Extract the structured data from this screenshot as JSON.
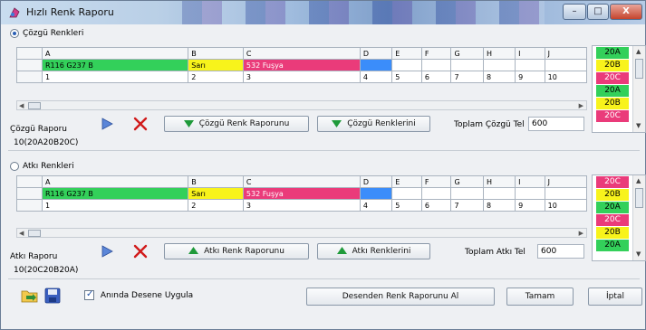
{
  "window": {
    "title": "Hızlı Renk Raporu",
    "minimize": "–",
    "maximize": "□",
    "close": "X"
  },
  "columns": [
    "A",
    "B",
    "C",
    "D",
    "E",
    "F",
    "G",
    "H",
    "I",
    "J"
  ],
  "colors": {
    "green": "#33d05a",
    "yellow": "#f8f31b",
    "pink": "#ea3b7a",
    "blue": "#3b8dfa"
  },
  "warp": {
    "section_label": "Çözgü Renkleri",
    "selected": true,
    "color_row": [
      "R116 G237 B",
      "Sarı",
      "532 Fuşya",
      "",
      "",
      "",
      "",
      "",
      "",
      ""
    ],
    "index_row": [
      "1",
      "2",
      "3",
      "4",
      "5",
      "6",
      "7",
      "8",
      "9",
      "10"
    ],
    "swatches": [
      {
        "label": "20A",
        "color": "#33d05a"
      },
      {
        "label": "20B",
        "color": "#f8f31b"
      },
      {
        "label": "20C",
        "color": "#ea3b7a"
      },
      {
        "label": "20A",
        "color": "#33d05a"
      },
      {
        "label": "20B",
        "color": "#f8f31b"
      },
      {
        "label": "20C",
        "color": "#ea3b7a"
      }
    ],
    "report_label": "Çözgü Raporu",
    "report_button": "Çözgü Renk Raporunu",
    "colors_button": "Çözgü Renklerini",
    "total_label": "Toplam Çözgü Tel",
    "total_value": "600",
    "report_text": "10(20A20B20C)"
  },
  "weft": {
    "section_label": "Atkı Renkleri",
    "selected": false,
    "color_row": [
      "R116 G237 B",
      "Sarı",
      "532 Fuşya",
      "",
      "",
      "",
      "",
      "",
      "",
      ""
    ],
    "index_row": [
      "1",
      "2",
      "3",
      "4",
      "5",
      "6",
      "7",
      "8",
      "9",
      "10"
    ],
    "swatches": [
      {
        "label": "20C",
        "color": "#ea3b7a"
      },
      {
        "label": "20B",
        "color": "#f8f31b"
      },
      {
        "label": "20A",
        "color": "#33d05a"
      },
      {
        "label": "20C",
        "color": "#ea3b7a"
      },
      {
        "label": "20B",
        "color": "#f8f31b"
      },
      {
        "label": "20A",
        "color": "#33d05a"
      }
    ],
    "report_label": "Atkı Raporu",
    "report_button": "Atkı Renk Raporunu",
    "colors_button": "Atkı Renklerini",
    "total_label": "Toplam Atkı Tel",
    "total_value": "600",
    "report_text": "10(20C20B20A)"
  },
  "footer": {
    "apply_checkbox_label": "Anında Desene Uygula",
    "apply_checked": true,
    "get_report_button": "Desenden Renk Raporunu Al",
    "ok_button": "Tamam",
    "cancel_button": "İptal"
  }
}
